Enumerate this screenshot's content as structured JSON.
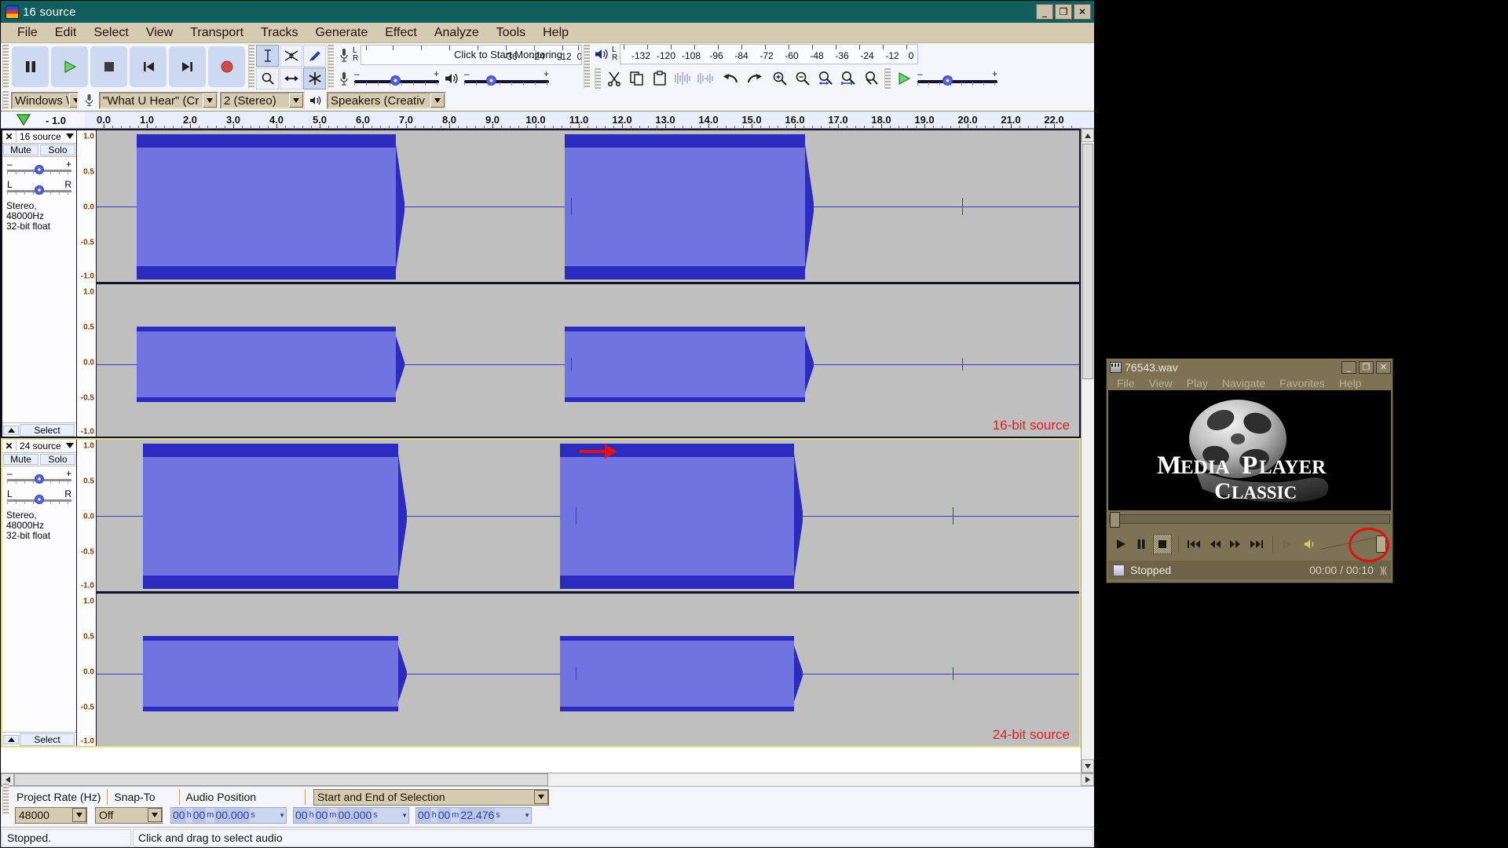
{
  "audacity": {
    "title": "16 source",
    "window_buttons": [
      "_",
      "❐",
      "✕"
    ],
    "menus": [
      "File",
      "Edit",
      "Select",
      "View",
      "Transport",
      "Tracks",
      "Generate",
      "Effect",
      "Analyze",
      "Tools",
      "Help"
    ],
    "transport_buttons": [
      {
        "name": "pause",
        "label": "Pause"
      },
      {
        "name": "play",
        "label": "Play"
      },
      {
        "name": "stop",
        "label": "Stop"
      },
      {
        "name": "skip-start",
        "label": "Skip to Start"
      },
      {
        "name": "skip-end",
        "label": "Skip to End"
      },
      {
        "name": "record",
        "label": "Record"
      }
    ],
    "tools": [
      {
        "name": "selection-tool",
        "label": "Selection Tool"
      },
      {
        "name": "envelope-tool",
        "label": "Envelope Tool"
      },
      {
        "name": "draw-tool",
        "label": "Draw Tool"
      },
      {
        "name": "zoom-tool",
        "label": "Zoom Tool"
      },
      {
        "name": "timeshift-tool",
        "label": "Time Shift Tool"
      },
      {
        "name": "multi-tool",
        "label": "Multi Tool"
      }
    ],
    "recording_meter": {
      "monitor_text": "Click to Start Monitoring",
      "labels": [
        "-36",
        "-24",
        "-12",
        "0"
      ],
      "channels": "L/R"
    },
    "playback_meter": {
      "labels": [
        "-132",
        "-120",
        "-108",
        "-96",
        "-84",
        "-72",
        "-60",
        "-48",
        "-36",
        "-24",
        "-12",
        "0"
      ],
      "channels": "L/R"
    },
    "slider_minus": "–",
    "slider_plus": "+",
    "edit_buttons": [
      "cut",
      "copy",
      "paste",
      "trim-audio",
      "silence-audio",
      "undo",
      "redo",
      "zoom-in",
      "zoom-out",
      "fit-selection",
      "fit-project",
      "zoom-toggle"
    ],
    "play_at_speed_label": "Play-at-Speed",
    "device_toolbar": {
      "host": "Windows \\",
      "recording_device": "\"What U Hear\" (Cr",
      "channels": "2 (Stereo)",
      "playback_device": "Speakers (Creativ"
    },
    "ruler": {
      "quick_play": "quick-play-indicator",
      "minus_one": "- 1.0",
      "labels": [
        "0.0",
        "1.0",
        "2.0",
        "3.0",
        "4.0",
        "5.0",
        "6.0",
        "7.0",
        "8.0",
        "9.0",
        "10.0",
        "11.0",
        "12.0",
        "13.0",
        "14.0",
        "15.0",
        "16.0",
        "17.0",
        "18.0",
        "19.0",
        "20.0",
        "21.0",
        "22.0"
      ]
    },
    "tracks": [
      {
        "close": "✕",
        "name": "16 source",
        "mute": "Mute",
        "solo": "Solo",
        "gain_minus": "–",
        "gain_plus": "+",
        "pan_left": "L",
        "pan_right": "R",
        "info_line1": "Stereo, 48000Hz",
        "info_line2": "32-bit float",
        "select": "Select",
        "vruler_labels": [
          "1.0",
          "0.5",
          "0.0",
          "-0.5",
          "-1.0"
        ],
        "annotation": "16-bit source",
        "selected": false
      },
      {
        "close": "✕",
        "name": "24 source",
        "mute": "Mute",
        "solo": "Solo",
        "gain_minus": "–",
        "gain_plus": "+",
        "pan_left": "L",
        "pan_right": "R",
        "info_line1": "Stereo, 48000Hz",
        "info_line2": "32-bit float",
        "select": "Select",
        "vruler_labels": [
          "1.0",
          "0.5",
          "0.0",
          "-0.5",
          "-1.0"
        ],
        "annotation": "24-bit source",
        "selected": true
      }
    ],
    "selection_toolbar": {
      "project_rate_label": "Project Rate (Hz)",
      "project_rate_value": "48000",
      "snap_to_label": "Snap-To",
      "snap_to_value": "Off",
      "audio_position_label": "Audio Position",
      "audio_position_value": {
        "h": "00",
        "hu": "h",
        "m": "00",
        "mu": "m",
        "s": "00.000",
        "su": "s"
      },
      "selection_mode": "Start and End of Selection",
      "selection_start": {
        "h": "00",
        "hu": "h",
        "m": "00",
        "mu": "m",
        "s": "00.000",
        "su": "s"
      },
      "selection_end": {
        "h": "00",
        "hu": "h",
        "m": "00",
        "mu": "m",
        "s": "22.476",
        "su": "s"
      }
    },
    "status": {
      "left": "Stopped.",
      "right": "Click and drag to select audio"
    }
  },
  "mpc": {
    "title": "76543.wav",
    "window_buttons": [
      "_",
      "❐",
      "✕"
    ],
    "menus": [
      "File",
      "View",
      "Play",
      "Navigate",
      "Favorites",
      "Help"
    ],
    "logo_line1": "Media",
    "logo_line2": "Player",
    "logo_line3": "Classic",
    "controls": [
      "play",
      "pause",
      "stop",
      "skip-back",
      "step-back",
      "step-forward",
      "skip-forward",
      "frame-step"
    ],
    "status_text": "Stopped",
    "time": "00:00 / 00:10"
  },
  "colors": {
    "titlebar": "#115e5e",
    "chrome": "#d4cbb0",
    "waveform_peak": "#2b2bc0",
    "waveform_rms": "#6f74e0",
    "wave_background": "#bfbfbf",
    "annotation_red": "#e02020",
    "mpc_chrome": "#7d7354"
  }
}
